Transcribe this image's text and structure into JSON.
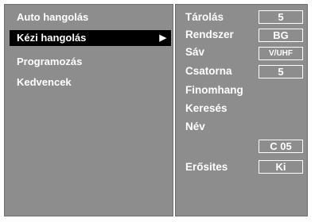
{
  "menu": {
    "items": [
      {
        "label": "Auto hangolás"
      },
      {
        "label": "Kézi hangolás",
        "arrow": "▶"
      },
      {
        "label": "Programozás"
      },
      {
        "label": "Kedvencek"
      }
    ]
  },
  "settings": {
    "tarolas": {
      "label": "Tárolás",
      "value": "5"
    },
    "rendszer": {
      "label": "Rendszer",
      "value": "BG"
    },
    "sav": {
      "label": "Sáv",
      "value": "V/UHF"
    },
    "csatorna": {
      "label": "Csatorna",
      "value": "5"
    },
    "finomhang": {
      "label": "Finomhang"
    },
    "kereses": {
      "label": "Keresés"
    },
    "nev": {
      "label": "Név",
      "value": "C 05"
    },
    "erosites": {
      "label": "Erősites",
      "value": "Ki"
    }
  }
}
